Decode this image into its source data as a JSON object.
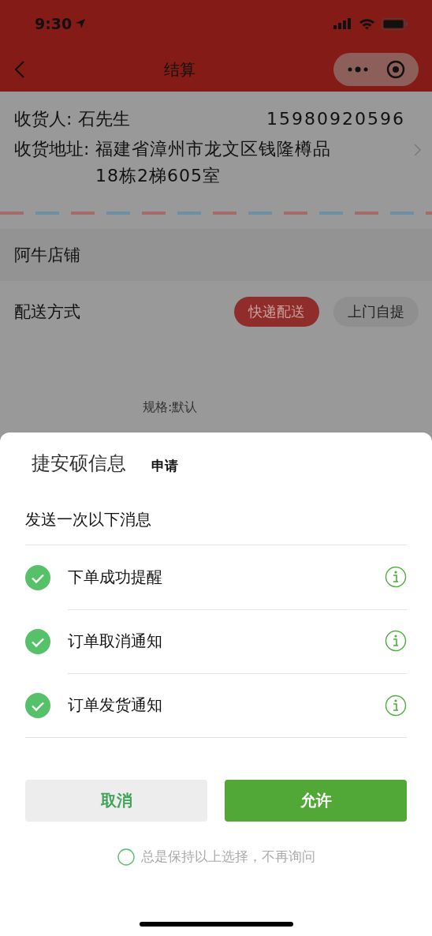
{
  "status_bar": {
    "time": "9:30"
  },
  "nav": {
    "title": "结算"
  },
  "recipient": {
    "label": "收货人:",
    "name": "石先生",
    "phone": "15980920596"
  },
  "address": {
    "label": "收货地址:",
    "line_1": "福建省漳州市龙文区钱隆樽品",
    "line_2": "18栋2梯605室"
  },
  "shop": {
    "name": "阿牛店铺"
  },
  "delivery": {
    "label": "配送方式",
    "options": [
      {
        "label": "快递配送",
        "selected": true
      },
      {
        "label": "上门自提",
        "selected": false
      }
    ]
  },
  "spec": "规格:默认",
  "sheet": {
    "app_name": "捷安硕信息",
    "action": "申请",
    "heading": "发送一次以下消息",
    "items": [
      {
        "label": "下单成功提醒",
        "checked": true
      },
      {
        "label": "订单取消通知",
        "checked": true
      },
      {
        "label": "订单发货通知",
        "checked": true
      }
    ],
    "buttons": [
      {
        "label": "取消",
        "kind": "secondary"
      },
      {
        "label": "允许",
        "kind": "primary"
      }
    ],
    "remember": {
      "label": "总是保持以上选择，不再询问",
      "checked": false
    }
  }
}
